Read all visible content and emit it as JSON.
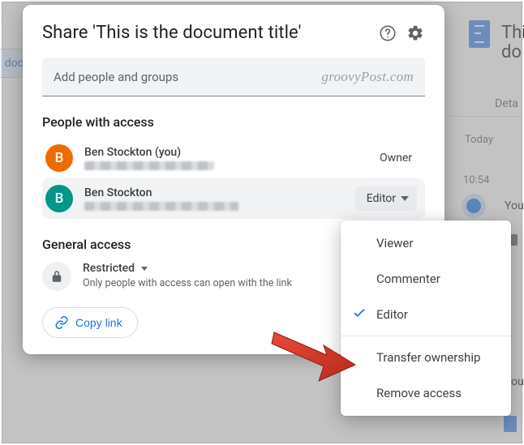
{
  "dialog": {
    "title": "Share 'This is the document title'",
    "input_placeholder": "Add people and groups",
    "watermark": "groovyPost.com",
    "people_heading": "People with access",
    "general_heading": "General access",
    "owner_label": "Owner",
    "people": [
      {
        "initial": "B",
        "name": "Ben Stockton (you)",
        "role": "Owner"
      },
      {
        "initial": "B",
        "name": "Ben Stockton",
        "role": "Editor"
      }
    ],
    "general_access": {
      "mode": "Restricted",
      "description": "Only people with access can open with the link"
    },
    "copy_link_label": "Copy link"
  },
  "role_menu": {
    "options": [
      "Viewer",
      "Commenter",
      "Editor"
    ],
    "selected": "Editor",
    "actions": [
      "Transfer ownership",
      "Remove access"
    ]
  },
  "background": {
    "title_line1": "Thi",
    "title_line2": "do",
    "tab": "Deta",
    "today_label": "Today",
    "time": "10:54",
    "you_label": "You",
    "left_chip": "doc"
  },
  "colors": {
    "primary": "#1a73e8",
    "avatar_owner": "#ed6c02",
    "avatar_editor": "#009688"
  }
}
